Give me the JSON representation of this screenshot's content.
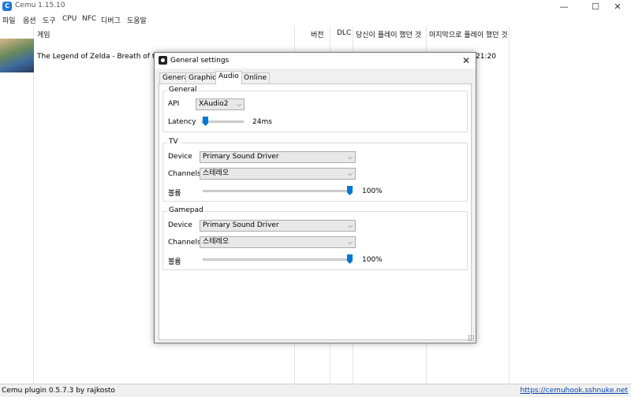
{
  "window": {
    "title": "Cemu 1.15.10",
    "minimize": "—",
    "maximize": "☐",
    "close": "✕"
  },
  "menu": [
    "파일",
    "옵션",
    "도구",
    "CPU",
    "NFC",
    "디버그",
    "도움말"
  ],
  "game_list": {
    "headers": {
      "game": "게임",
      "version": "버전",
      "dlc": "DLC",
      "played": "당신이 플레이 했던 것",
      "last_played": "마지막으로 플레이 했던 것"
    },
    "rows": [
      {
        "title": "The Legend of Zelda - Breath of the Wild",
        "last_played": "21:20"
      }
    ]
  },
  "status": {
    "left": "Cemu plugin 0.5.7.3 by rajkosto",
    "link": "https://cemuhook.sshnuke.net"
  },
  "dialog": {
    "title": "General settings",
    "close": "✕",
    "tabs": [
      "General",
      "Graphics",
      "Audio",
      "Online"
    ],
    "active_tab": "Audio",
    "general": {
      "title": "General",
      "api_label": "API",
      "api_value": "XAudio2",
      "latency_label": "Latency",
      "latency_value": "24ms",
      "latency_fraction": 0.1
    },
    "tv": {
      "title": "TV",
      "device_label": "Device",
      "device_value": "Primary Sound Driver",
      "channels_label": "Channels",
      "channels_value": "스테레오",
      "volume_label": "볼륨",
      "volume_value": "100%",
      "volume_fraction": 1.0
    },
    "gamepad": {
      "title": "Gamepad",
      "device_label": "Device",
      "device_value": "Primary Sound Driver",
      "channels_label": "Channels",
      "channels_value": "스테레오",
      "volume_label": "볼륨",
      "volume_value": "100%",
      "volume_fraction": 1.0
    }
  },
  "colors": {
    "accent": "#0078d7",
    "link": "#0645ad"
  }
}
